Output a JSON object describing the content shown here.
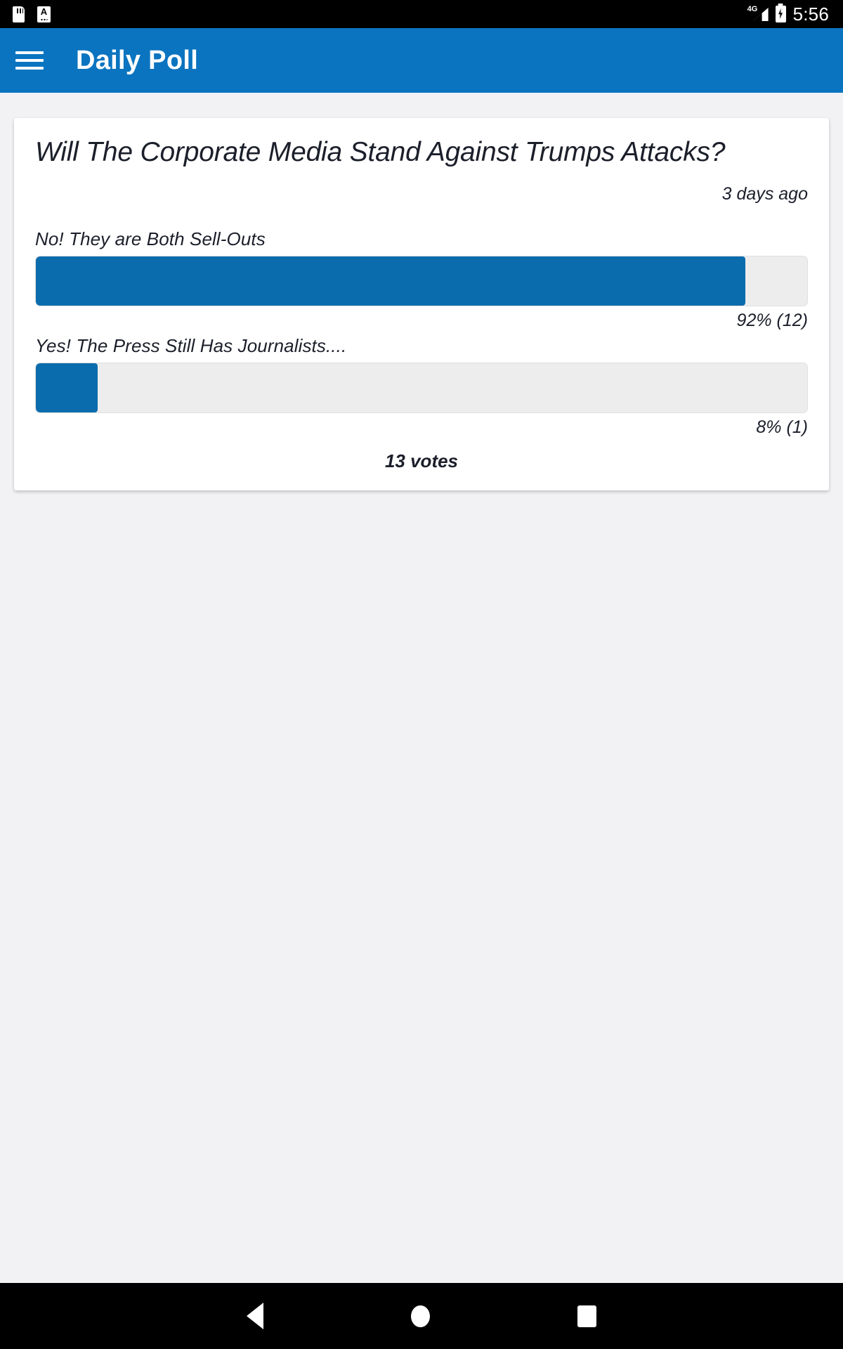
{
  "status_bar": {
    "icons": [
      "sd-card-icon",
      "document-a-icon"
    ],
    "network": "4G",
    "battery": "charging",
    "time": "5:56"
  },
  "app_bar": {
    "menu_icon": "hamburger-menu-icon",
    "title": "Daily Poll",
    "background_color": "#0b74c0"
  },
  "poll": {
    "question": "Will The Corporate Media Stand Against Trumps Attacks?",
    "timestamp": "3 days ago",
    "total_votes": "13 votes",
    "accent_color": "#0b6cad",
    "track_color": "#ededed",
    "options": [
      {
        "label": "No! They are Both Sell-Outs",
        "value_text": "92% (12)",
        "percent": 92,
        "count": 12
      },
      {
        "label": "Yes! The Press Still Has Journalists....",
        "value_text": "8% (1)",
        "percent": 8,
        "count": 1
      }
    ]
  },
  "nav_bar": {
    "back": "back-triangle-icon",
    "home": "home-circle-icon",
    "recents": "recents-square-icon"
  }
}
